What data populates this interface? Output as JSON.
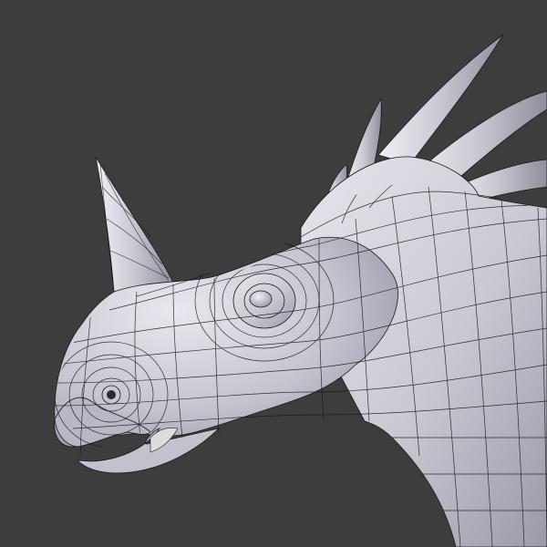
{
  "viewport": {
    "background": "#3d3d3d",
    "shading": "solid-matcap",
    "overlay": "wireframe"
  },
  "model": {
    "subject": "styracosaurus-head",
    "surface_color": "#c9c9d3",
    "shadow_color": "#8e8e9c",
    "highlight_color": "#eeeef6",
    "wire_color": "#151515",
    "parts": [
      "nose-horn",
      "frill-spikes",
      "frill",
      "eye",
      "beak",
      "jaw",
      "neck"
    ]
  }
}
